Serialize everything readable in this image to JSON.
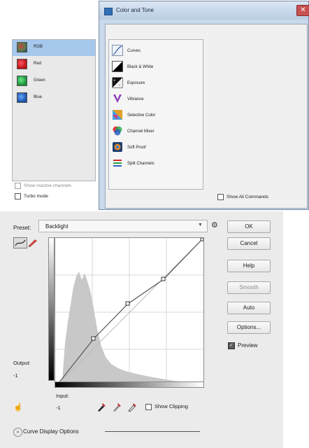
{
  "color_tone": {
    "title": "Color and Tone",
    "channels": [
      {
        "label": "RGB",
        "selected": true,
        "color": "#5a7f4a"
      },
      {
        "label": "Red",
        "selected": false,
        "color": "#d22b2b"
      },
      {
        "label": "Green",
        "selected": false,
        "color": "#28a745"
      },
      {
        "label": "Blue",
        "selected": false,
        "color": "#2a63c2"
      }
    ],
    "commands": [
      {
        "label": "Curves",
        "icon": "curves-icon"
      },
      {
        "label": "Black & White",
        "icon": "black-white-icon"
      },
      {
        "label": "Exposure",
        "icon": "exposure-icon"
      },
      {
        "label": "Vibrance",
        "icon": "vibrance-icon"
      },
      {
        "label": "Selective Color",
        "icon": "selective-color-icon"
      },
      {
        "label": "Channel Mixer",
        "icon": "channel-mixer-icon"
      },
      {
        "label": "Soft Proof",
        "icon": "soft-proof-icon"
      },
      {
        "label": "Split Channels",
        "icon": "split-channels-icon"
      }
    ],
    "show_inactive_label": "Show inactive channels",
    "turbo_label": "Turbo mode",
    "show_all_label": "Show All Commands"
  },
  "curves": {
    "preset_label": "Preset:",
    "preset_value": "Backlight",
    "output_label": "Output:",
    "output_value": "-1",
    "input_label": "Input:",
    "input_value": "-1",
    "show_clipping_label": "Show Clipping",
    "display_options_label": "Curve Display Options",
    "buttons": {
      "ok": "OK",
      "cancel": "Cancel",
      "help": "Help",
      "smooth": "Smooth",
      "auto": "Auto",
      "options": "Options..."
    },
    "preview_label": "Preview",
    "preview_checked": true
  }
}
